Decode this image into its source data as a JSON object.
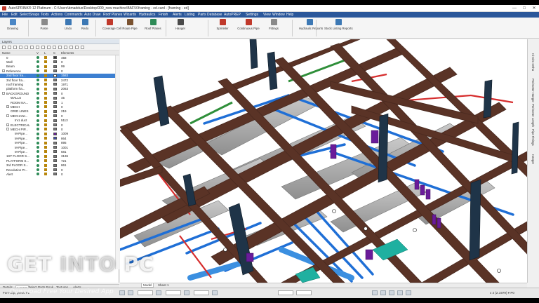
{
  "window": {
    "title": "AutoSPRINK® 12 Platinum - C:\\Users\\bmaddux\\Desktop\\000_new machine\\BAF\\X\\framing - ed.card - [framing - ed]",
    "controls": [
      "—",
      "□",
      "✕"
    ]
  },
  "menu": [
    "File",
    "Edit",
    "Select",
    "Snaps",
    "Texts",
    "Actions",
    "Commands",
    "Auto Draw",
    "Roof Planes",
    "Wizards",
    "Hydraulics",
    "Finish",
    "Alerts",
    "Listing",
    "Parts Database",
    "AutoPREP",
    "Settings",
    "View",
    "Window",
    "Help"
  ],
  "toolbar": [
    {
      "label": "Drawing",
      "icon": "drawing-icon",
      "color": "#4a86c5"
    },
    {
      "label": "Paste",
      "icon": "paste-icon",
      "color": "#8a8a8a"
    },
    {
      "label": "Undo",
      "icon": "undo-icon",
      "color": "#3c78b4"
    },
    {
      "label": "Redo",
      "icon": "redo-icon",
      "color": "#3c78b4"
    },
    {
      "label": "Coverage Cell",
      "icon": "coverage-icon",
      "color": "#c0392b"
    },
    {
      "label": "Route Pipe",
      "icon": "route-pipe-icon",
      "color": "#7a5230"
    },
    {
      "label": "Roof Planes",
      "icon": "roof-icon",
      "color": "#2e8b57"
    },
    {
      "label": "Hanger",
      "icon": "hanger-icon",
      "color": "#4a4a4a"
    },
    {
      "label": "Sprinkler",
      "icon": "sprinkler-icon",
      "color": "#c0392b"
    },
    {
      "label": "Continuous Pipe",
      "icon": "continuous-pipe-icon",
      "color": "#c0392b"
    },
    {
      "label": "Fittings",
      "icon": "fittings-icon",
      "color": "#8a8a8a"
    },
    {
      "label": "Hydraulic Reports",
      "icon": "hydraulic-icon",
      "color": "#3c78b4"
    },
    {
      "label": "Stock Listing Reports",
      "icon": "stock-listing-icon",
      "color": "#3c78b4"
    }
  ],
  "layers": {
    "panel_title": "Layers",
    "columns": [
      "Name",
      "V",
      "L",
      "C",
      "Elements"
    ],
    "rows": [
      {
        "name": "0",
        "indent": 0,
        "color": "#333333",
        "count": "458",
        "selected": false,
        "expander": ""
      },
      {
        "name": "Wall",
        "indent": 0,
        "color": "#7a7a7a",
        "count": "0",
        "selected": false,
        "expander": ""
      },
      {
        "name": "Beam",
        "indent": 0,
        "color": "#7a7a7a",
        "count": "99",
        "selected": false,
        "expander": ""
      },
      {
        "name": "Reference",
        "indent": 0,
        "color": "#7a7a7a",
        "count": "0",
        "selected": false,
        "expander": "+"
      },
      {
        "name": "2nd floor fra...",
        "indent": 0,
        "color": "#ffffff",
        "count": "1583",
        "selected": true,
        "expander": ""
      },
      {
        "name": "3rd floor fra...",
        "indent": 0,
        "color": "#7a7a7a",
        "count": "2472",
        "selected": false,
        "expander": ""
      },
      {
        "name": "roof framing",
        "indent": 0,
        "color": "#7a7a7a",
        "count": "1971",
        "selected": false,
        "expander": ""
      },
      {
        "name": "platform fra...",
        "indent": 0,
        "color": "#7a7a7a",
        "count": "2063",
        "selected": false,
        "expander": ""
      },
      {
        "name": "BACKGROUND",
        "indent": 0,
        "color": "#7a7a7a",
        "count": "0",
        "selected": false,
        "expander": "-"
      },
      {
        "name": "WALLS",
        "indent": 1,
        "color": "#7a7a7a",
        "count": "45",
        "selected": false,
        "expander": ""
      },
      {
        "name": "ROOM NA...",
        "indent": 1,
        "color": "#7a7a7a",
        "count": "1",
        "selected": false,
        "expander": ""
      },
      {
        "name": "MECH",
        "indent": 1,
        "color": "#7a7a7a",
        "count": "0",
        "selected": false,
        "expander": "+"
      },
      {
        "name": "GRID LINES",
        "indent": 1,
        "color": "#7a7a7a",
        "count": "219",
        "selected": false,
        "expander": ""
      },
      {
        "name": "MECHANI...",
        "indent": 1,
        "color": "#7a7a7a",
        "count": "0",
        "selected": false,
        "expander": "-"
      },
      {
        "name": "trv1 duct",
        "indent": 2,
        "color": "#7a7a7a",
        "count": "5113",
        "selected": false,
        "expander": ""
      },
      {
        "name": "ELECTRICAL",
        "indent": 1,
        "color": "#7a7a7a",
        "count": "0",
        "selected": false,
        "expander": "+"
      },
      {
        "name": "MECH PIP...",
        "indent": 1,
        "color": "#7a7a7a",
        "count": "0",
        "selected": false,
        "expander": "-"
      },
      {
        "name": "M-Pipe...",
        "indent": 2,
        "color": "#6a1b9a",
        "count": "1009",
        "selected": false,
        "expander": ""
      },
      {
        "name": "M-Pipe...",
        "indent": 2,
        "color": "#3949ab",
        "count": "864",
        "selected": false,
        "expander": ""
      },
      {
        "name": "M-Pipe...",
        "indent": 2,
        "color": "#7a7a7a",
        "count": "895",
        "selected": false,
        "expander": ""
      },
      {
        "name": "M-Pipe...",
        "indent": 2,
        "color": "#7a7a7a",
        "count": "1001",
        "selected": false,
        "expander": ""
      },
      {
        "name": "M-Pipe...",
        "indent": 2,
        "color": "#7a7a7a",
        "count": "681",
        "selected": false,
        "expander": ""
      },
      {
        "name": "1ST FLOOR S...",
        "indent": 0,
        "color": "#7a7a7a",
        "count": "3136",
        "selected": false,
        "expander": ""
      },
      {
        "name": "PLATFORM S...",
        "indent": 0,
        "color": "#7a7a7a",
        "count": "721",
        "selected": false,
        "expander": ""
      },
      {
        "name": "3rd FLOOR S...",
        "indent": 0,
        "color": "#7a7a7a",
        "count": "861",
        "selected": false,
        "expander": ""
      },
      {
        "name": "Revolution Pr...",
        "indent": 0,
        "color": "#7a7a7a",
        "count": "0",
        "selected": false,
        "expander": ""
      },
      {
        "name": "Alert",
        "indent": 0,
        "color": "#7a7a7a",
        "count": "0",
        "selected": false,
        "expander": ""
      }
    ]
  },
  "panel_tabs": [
    "Details",
    "Layers",
    "Select",
    "Parts Book",
    "Textures",
    "Alerts"
  ],
  "panel_tabs_active": "Layers",
  "viewport_tabs": [
    "Model",
    "Sheet 1"
  ],
  "viewport_tabs_active": "Model",
  "right_palette": [
    "Hi-Dim Ortho",
    "Perimeter Hanger",
    "Perimeter Length",
    "Pipe Fittings",
    "Hanger"
  ],
  "status": {
    "help": "For Help, press F1",
    "coords": "x 2 (2.1979) ▾ P0"
  },
  "watermark": {
    "text_a": "GET",
    "text_b": "INTO",
    "text_c": "PC",
    "subtitle": "Download Free Your Desired App"
  }
}
